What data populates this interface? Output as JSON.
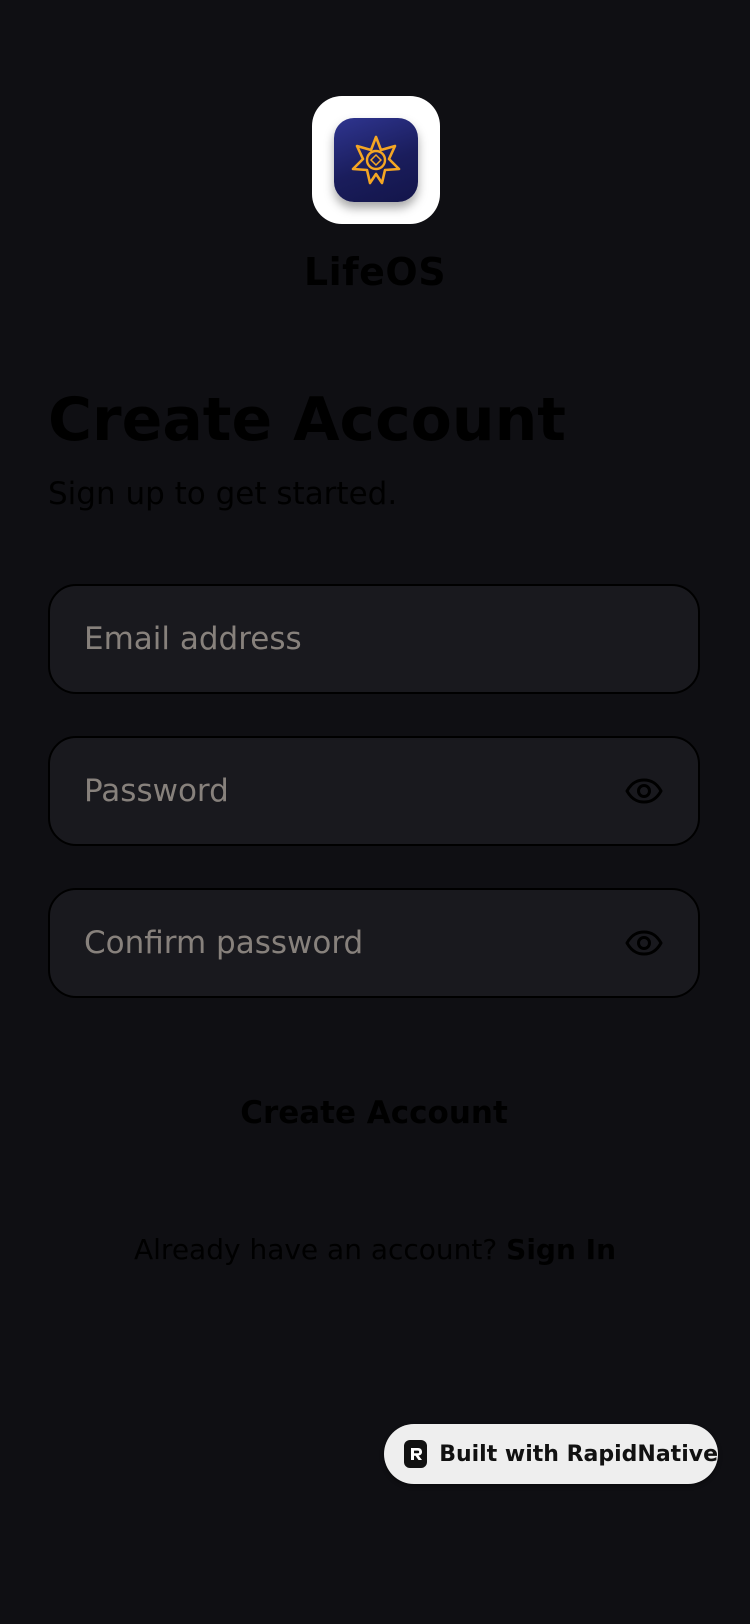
{
  "app": {
    "name": "LifeOS",
    "icon": "star-emblem-icon",
    "icon_colors": {
      "tile": "#ffffff",
      "inner_start": "#2f3590",
      "inner_end": "#13154a",
      "star": "#f5a623"
    }
  },
  "page": {
    "title": "Create Account",
    "subtitle": "Sign up to get started."
  },
  "form": {
    "email": {
      "placeholder": "Email address",
      "value": ""
    },
    "password": {
      "placeholder": "Password",
      "value": "",
      "toggle_icon": "eye-icon"
    },
    "confirm_password": {
      "placeholder": "Confirm password",
      "value": "",
      "toggle_icon": "eye-icon"
    },
    "submit_label": "Create Account"
  },
  "footer": {
    "prompt": "Already have an account?",
    "link_label": "Sign In"
  },
  "badge": {
    "label": "Built with RapidNative",
    "icon": "rapidnative-logo-icon"
  },
  "colors": {
    "background": "#0f0f13",
    "field_background": "#19191e",
    "placeholder": "#87817c",
    "badge_background": "#eeeeee"
  }
}
